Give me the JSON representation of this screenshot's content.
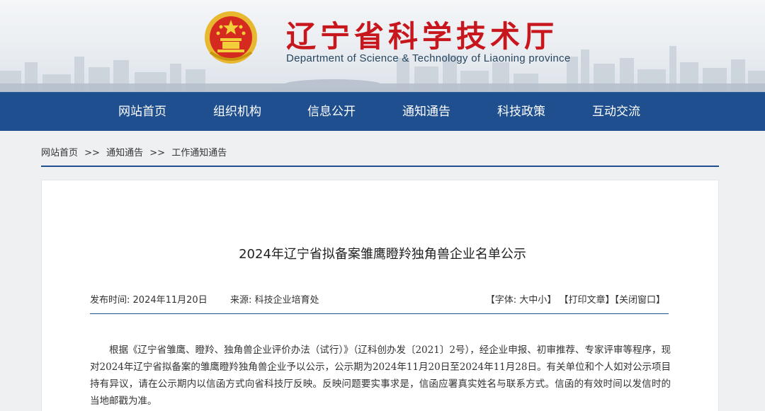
{
  "header": {
    "title": "辽宁省科学技术厅",
    "subtitle": "Department of Science & Technology of Liaoning province",
    "emblem_icon": "national-emblem-icon",
    "colors": {
      "title": "#c8161d",
      "subtitle": "#26465f"
    }
  },
  "nav": {
    "background": "#1f4f8e",
    "items": [
      {
        "label": "网站首页"
      },
      {
        "label": "组织机构"
      },
      {
        "label": "信息公开"
      },
      {
        "label": "通知通告"
      },
      {
        "label": "科技政策"
      },
      {
        "label": "互动交流"
      }
    ]
  },
  "breadcrumb": {
    "items": [
      "网站首页",
      "通知通告",
      "工作通知通告"
    ],
    "separator": ">>"
  },
  "article": {
    "title": "2024年辽宁省拟备案雏鹰瞪羚独角兽企业名单公示",
    "published_label": "发布时间:",
    "published_date": "2024年11月20日",
    "source_label": "来源:",
    "source": "科技企业培育处",
    "tools": {
      "font_label": "【字体:",
      "font_sizes": [
        "大",
        "中",
        "小"
      ],
      "font_close": "】",
      "print": "【打印文章】",
      "close": "【关闭窗口】"
    },
    "body": "根据《辽宁省雏鹰、瞪羚、独角兽企业评价办法（试行）》（辽科创办发〔2021〕2号），经企业申报、初审推荐、专家评审等程序，现对2024年辽宁省拟备案的雏鹰瞪羚独角兽企业予以公示，公示期为2024年11月20日至2024年11月28日。有关单位和个人如对公示项目持有异议，请在公示期内以信函方式向省科技厅反映。反映问题要实事求是，信函应署真实姓名与联系方式。信函的有效时间以发信时的当地邮戳为准。"
  }
}
